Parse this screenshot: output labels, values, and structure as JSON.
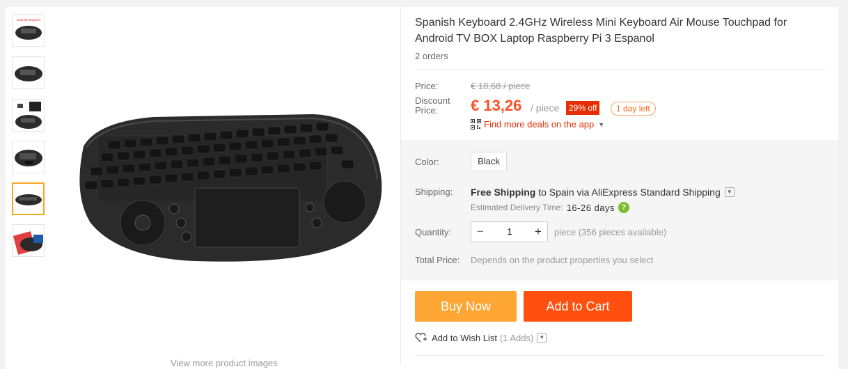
{
  "product": {
    "title": "Spanish Keyboard 2.4GHz Wireless Mini Keyboard Air Mouse Touchpad for Android TV BOX Laptop Raspberry Pi 3 Espanol",
    "orders": "2 orders"
  },
  "gallery": {
    "thumb1_caption": "Spanish Espanol",
    "more_caption": "View more product images"
  },
  "price": {
    "price_label": "Price:",
    "old_price": "€ 18,68 / piece",
    "discount_label": "Discount Price:",
    "current_price": "€ 13,26",
    "per_piece": "/ piece",
    "discount_badge": "29% off",
    "time_left": "1 day left",
    "deals_link": "Find more deals on the app"
  },
  "options": {
    "color_label": "Color:",
    "color_value": "Black",
    "shipping_label": "Shipping:",
    "shipping_free": "Free Shipping",
    "shipping_to": " to Spain via AliExpress Standard Shipping",
    "eta_label": "Estimated Delivery Time:",
    "eta_days": "16-26 days",
    "quantity_label": "Quantity:",
    "quantity_value": "1",
    "quantity_avail": "piece (356 pieces available)",
    "total_label": "Total Price:",
    "total_value": "Depends on the product properties you select"
  },
  "actions": {
    "buy_now": "Buy Now",
    "add_to_cart": "Add to Cart",
    "wishlist": "Add to Wish List",
    "wishlist_count": "(1 Adds)"
  },
  "colors": {
    "price_red": "#ff4f24",
    "buy_now_bg": "#fea634",
    "add_cart_bg": "#ff4f0e",
    "badge_red": "#e62e04",
    "thumb_active": "#f5a623"
  }
}
